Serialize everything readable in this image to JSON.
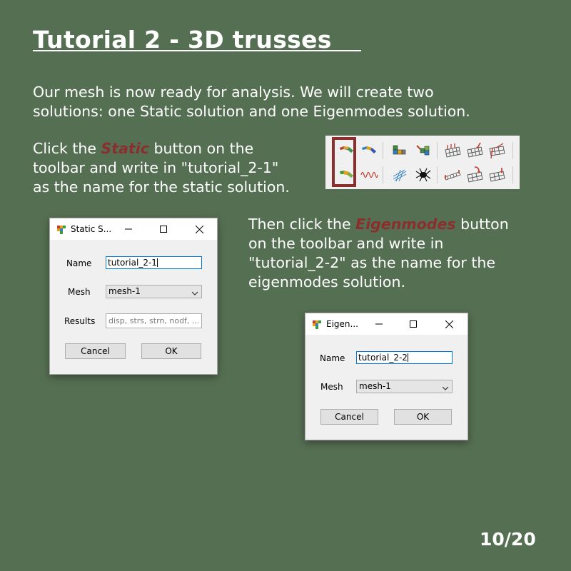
{
  "slide": {
    "title": "Tutorial 2 - 3D trusses",
    "intro_line1": "Our mesh is now ready for analysis. We will create two",
    "intro_line2": "solutions: one Static solution and one Eigenmodes solution.",
    "static_line1_pre": "Click the ",
    "static_keyword": "Static",
    "static_line1_post": " button on the",
    "static_line2": "toolbar and write in \"tutorial_2-1\"",
    "static_line3": "as the name for the static solution.",
    "eigen_line1_pre": "Then click the ",
    "eigen_keyword": "Eigenmodes",
    "eigen_line1_post": " button",
    "eigen_line2": "on the toolbar and write in",
    "eigen_line3": "\"tutorial_2-2\" as the name for the",
    "eigen_line4": "eigenmodes solution.",
    "page_number": "10/20",
    "highlight_color": "#8a2f2e",
    "background_color": "#556f52"
  },
  "toolbar": {
    "icons_row1": [
      "static-solution-icon",
      "beam-solution-icon",
      "mesh-block-icon",
      "mesh-edit-icon",
      "grid-constraint-icon",
      "grid-load-icon",
      "grid-support-icon"
    ],
    "icons_row2": [
      "eigenmodes-solution-icon",
      "wave-icon",
      "scatter-icon",
      "spider-icon",
      "beam-load-icon",
      "grid-rotation-icon",
      "grid-node-icon"
    ]
  },
  "static_dialog": {
    "title": "Static S...",
    "name_label": "Name",
    "name_value": "tutorial_2-1",
    "mesh_label": "Mesh",
    "mesh_value": "mesh-1",
    "results_label": "Results",
    "results_placeholder": "disp, strs, strn, nodf, ...",
    "cancel_label": "Cancel",
    "ok_label": "OK"
  },
  "eigen_dialog": {
    "title": "Eigen...",
    "name_label": "Name",
    "name_value": "tutorial_2-2",
    "mesh_label": "Mesh",
    "mesh_value": "mesh-1",
    "cancel_label": "Cancel",
    "ok_label": "OK"
  }
}
